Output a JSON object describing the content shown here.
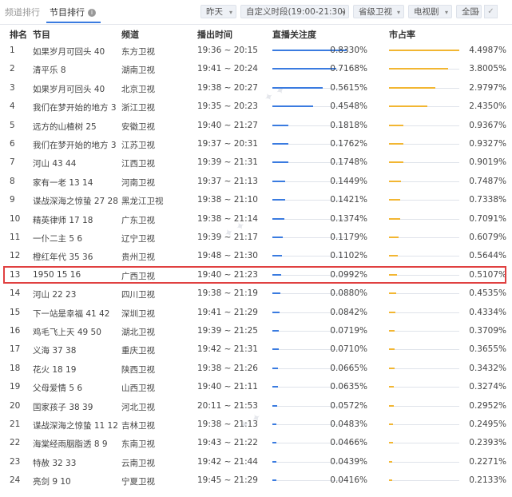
{
  "tabs": {
    "channel_rank": "频道排行",
    "program_rank": "节目排行",
    "info": "i"
  },
  "filters": [
    {
      "label": "昨天"
    },
    {
      "label": "自定义时段(19:00-21:30)"
    },
    {
      "label": "省级卫视"
    },
    {
      "label": "电视剧"
    },
    {
      "label": "全国"
    }
  ],
  "headers": {
    "rank": "排名",
    "program": "节目",
    "channel": "频道",
    "time": "播出时间",
    "attention": "直播关注度",
    "share": "市占率"
  },
  "colors": {
    "attention_bar": "#3a7be0",
    "share_bar": "#f2b632",
    "highlight": "#e04040"
  },
  "rows": [
    {
      "rank": "1",
      "program": "如果岁月可回头 40",
      "channel": "东方卫视",
      "time": "19:36 ~ 20:15",
      "attention": "0.8330%",
      "attention_v": 0.833,
      "share": "4.4987%",
      "share_v": 4.4987
    },
    {
      "rank": "2",
      "program": "清平乐 8",
      "channel": "湖南卫视",
      "time": "19:41 ~ 20:24",
      "attention": "0.7168%",
      "attention_v": 0.7168,
      "share": "3.8005%",
      "share_v": 3.8005
    },
    {
      "rank": "3",
      "program": "如果岁月可回头 40",
      "channel": "北京卫视",
      "time": "19:38 ~ 20:27",
      "attention": "0.5615%",
      "attention_v": 0.5615,
      "share": "2.9797%",
      "share_v": 2.9797
    },
    {
      "rank": "4",
      "program": "我们在梦开始的地方 3",
      "channel": "浙江卫视",
      "time": "19:35 ~ 20:23",
      "attention": "0.4548%",
      "attention_v": 0.4548,
      "share": "2.4350%",
      "share_v": 2.435
    },
    {
      "rank": "5",
      "program": "远方的山楂树 25",
      "channel": "安徽卫视",
      "time": "19:40 ~ 21:27",
      "attention": "0.1818%",
      "attention_v": 0.1818,
      "share": "0.9367%",
      "share_v": 0.9367
    },
    {
      "rank": "6",
      "program": "我们在梦开始的地方 3",
      "channel": "江苏卫视",
      "time": "19:37 ~ 20:31",
      "attention": "0.1762%",
      "attention_v": 0.1762,
      "share": "0.9327%",
      "share_v": 0.9327
    },
    {
      "rank": "7",
      "program": "河山 43 44",
      "channel": "江西卫视",
      "time": "19:39 ~ 21:31",
      "attention": "0.1748%",
      "attention_v": 0.1748,
      "share": "0.9019%",
      "share_v": 0.9019
    },
    {
      "rank": "8",
      "program": "家有一老 13 14",
      "channel": "河南卫视",
      "time": "19:37 ~ 21:13",
      "attention": "0.1449%",
      "attention_v": 0.1449,
      "share": "0.7487%",
      "share_v": 0.7487
    },
    {
      "rank": "9",
      "program": "谍战深海之惊蛰 27 28",
      "channel": "黑龙江卫视",
      "time": "19:38 ~ 21:10",
      "attention": "0.1421%",
      "attention_v": 0.1421,
      "share": "0.7338%",
      "share_v": 0.7338
    },
    {
      "rank": "10",
      "program": "精英律师 17 18",
      "channel": "广东卫视",
      "time": "19:38 ~ 21:14",
      "attention": "0.1374%",
      "attention_v": 0.1374,
      "share": "0.7091%",
      "share_v": 0.7091
    },
    {
      "rank": "11",
      "program": "一仆二主 5 6",
      "channel": "辽宁卫视",
      "time": "19:39 ~ 21:17",
      "attention": "0.1179%",
      "attention_v": 0.1179,
      "share": "0.6079%",
      "share_v": 0.6079
    },
    {
      "rank": "12",
      "program": "橙红年代 35 36",
      "channel": "贵州卫视",
      "time": "19:48 ~ 21:30",
      "attention": "0.1102%",
      "attention_v": 0.1102,
      "share": "0.5644%",
      "share_v": 0.5644
    },
    {
      "rank": "13",
      "program": "1950 15 16",
      "channel": "广西卫视",
      "time": "19:40 ~ 21:23",
      "attention": "0.0992%",
      "attention_v": 0.0992,
      "share": "0.5107%",
      "share_v": 0.5107,
      "highlighted": true
    },
    {
      "rank": "14",
      "program": "河山 22 23",
      "channel": "四川卫视",
      "time": "19:38 ~ 21:19",
      "attention": "0.0880%",
      "attention_v": 0.088,
      "share": "0.4535%",
      "share_v": 0.4535
    },
    {
      "rank": "15",
      "program": "下一站是幸福 41 42",
      "channel": "深圳卫视",
      "time": "19:41 ~ 21:29",
      "attention": "0.0842%",
      "attention_v": 0.0842,
      "share": "0.4334%",
      "share_v": 0.4334
    },
    {
      "rank": "16",
      "program": "鸡毛飞上天 49 50",
      "channel": "湖北卫视",
      "time": "19:39 ~ 21:25",
      "attention": "0.0719%",
      "attention_v": 0.0719,
      "share": "0.3709%",
      "share_v": 0.3709
    },
    {
      "rank": "17",
      "program": "义海 37 38",
      "channel": "重庆卫视",
      "time": "19:42 ~ 21:31",
      "attention": "0.0710%",
      "attention_v": 0.071,
      "share": "0.3655%",
      "share_v": 0.3655
    },
    {
      "rank": "18",
      "program": "花火 18 19",
      "channel": "陕西卫视",
      "time": "19:38 ~ 21:26",
      "attention": "0.0665%",
      "attention_v": 0.0665,
      "share": "0.3432%",
      "share_v": 0.3432
    },
    {
      "rank": "19",
      "program": "父母爱情 5 6",
      "channel": "山西卫视",
      "time": "19:40 ~ 21:11",
      "attention": "0.0635%",
      "attention_v": 0.0635,
      "share": "0.3274%",
      "share_v": 0.3274
    },
    {
      "rank": "20",
      "program": "国家孩子 38 39",
      "channel": "河北卫视",
      "time": "20:11 ~ 21:53",
      "attention": "0.0572%",
      "attention_v": 0.0572,
      "share": "0.2952%",
      "share_v": 0.2952
    },
    {
      "rank": "21",
      "program": "谍战深海之惊蛰 11 12",
      "channel": "吉林卫视",
      "time": "19:38 ~ 21:13",
      "attention": "0.0483%",
      "attention_v": 0.0483,
      "share": "0.2495%",
      "share_v": 0.2495
    },
    {
      "rank": "22",
      "program": "海棠经雨胭脂透 8 9",
      "channel": "东南卫视",
      "time": "19:43 ~ 21:22",
      "attention": "0.0466%",
      "attention_v": 0.0466,
      "share": "0.2393%",
      "share_v": 0.2393
    },
    {
      "rank": "23",
      "program": "特赦 32 33",
      "channel": "云南卫视",
      "time": "19:42 ~ 21:44",
      "attention": "0.0439%",
      "attention_v": 0.0439,
      "share": "0.2271%",
      "share_v": 0.2271
    },
    {
      "rank": "24",
      "program": "亮剑 9 10",
      "channel": "宁夏卫视",
      "time": "19:45 ~ 21:29",
      "attention": "0.0416%",
      "attention_v": 0.0416,
      "share": "0.2133%",
      "share_v": 0.2133
    }
  ]
}
